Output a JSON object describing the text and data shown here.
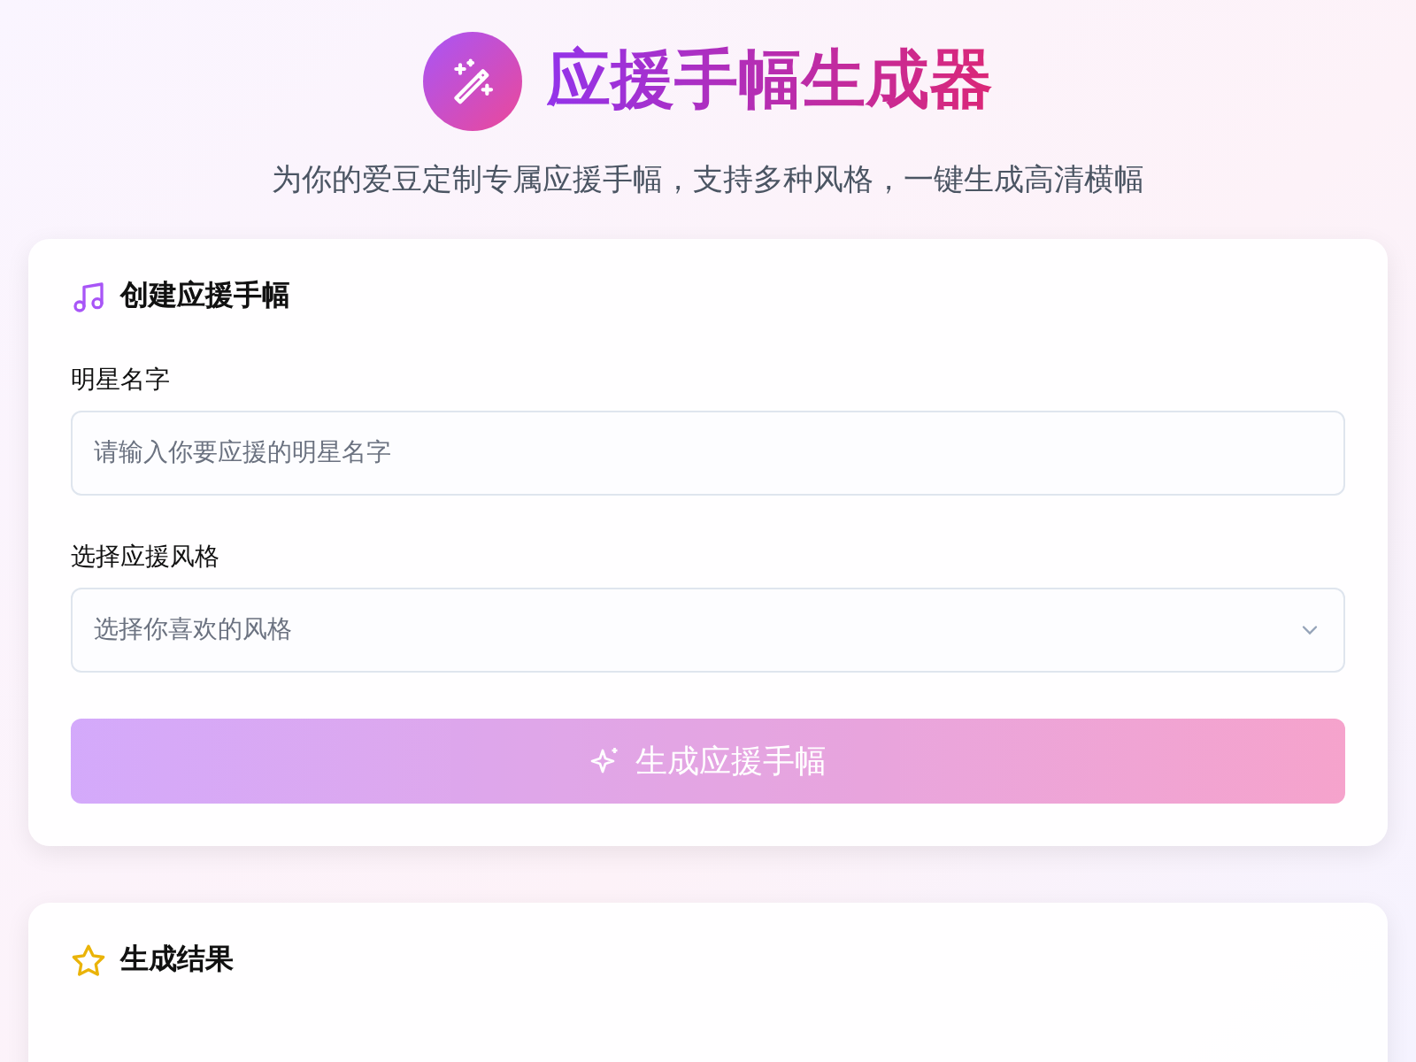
{
  "header": {
    "title": "应援手幅生成器",
    "subtitle": "为你的爱豆定制专属应援手幅，支持多种风格，一键生成高清横幅"
  },
  "create_card": {
    "title": "创建应援手幅",
    "name_field": {
      "label": "明星名字",
      "placeholder": "请输入你要应援的明星名字"
    },
    "style_select": {
      "label": "选择应援风格",
      "placeholder": "选择你喜欢的风格"
    },
    "generate_button": {
      "label": "生成应援手幅",
      "disabled": true
    }
  },
  "result_card": {
    "title": "生成结果"
  }
}
